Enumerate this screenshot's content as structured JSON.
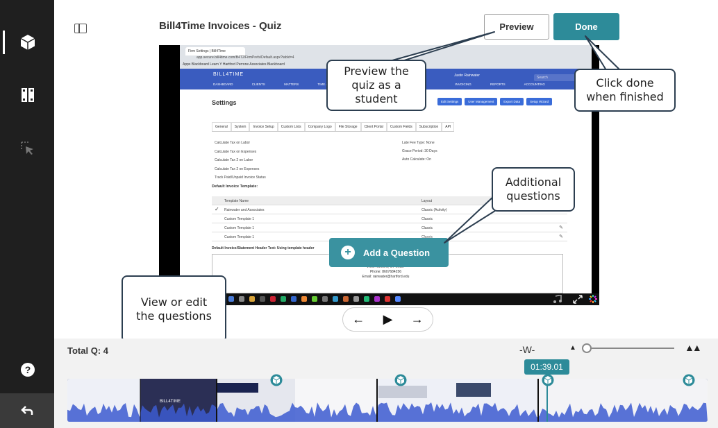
{
  "sidebar": {
    "items": [
      {
        "icon": "cube-icon",
        "active": true
      },
      {
        "icon": "split-video-icon",
        "active": false
      },
      {
        "icon": "cursor-select-icon",
        "active": false
      }
    ],
    "help_icon": "help-icon",
    "back_icon": "back-arrow-icon"
  },
  "header": {
    "title": "Bill4Time Invoices - Quiz",
    "preview_label": "Preview",
    "done_label": "Done"
  },
  "video": {
    "browser_tab": "Firm Settings | Bill4Time",
    "url": "app.secure.bill4time.com/B4T2/FirmPrefs/Default.aspx?tabId=4",
    "bookmarks": "Apps   Blackboard Learn   Y Hartford   Perrone Associates   Blackboard",
    "logo": "BILL4TIME",
    "nav": [
      "DASHBOARD",
      "CLIENTS",
      "MATTERS",
      "TIME & EXPENSES",
      "INVOICING",
      "REPORTS",
      "ACCOUNTING"
    ],
    "user": "Justin Rainwater",
    "search_placeholder": "Search",
    "settings_title": "Settings",
    "setting_buttons": [
      "Edit Settings",
      "User Management",
      "Export Data",
      "Setup Wizard"
    ],
    "tabs": [
      "General",
      "System",
      "Invoice Setup",
      "Custom Lists",
      "Company Logo",
      "File Storage",
      "Client Portal",
      "Custom Fields",
      "Subscription",
      "API"
    ],
    "options_left": [
      "Calculate Tax on Labor",
      "Calculate Tax on Expenses",
      "Calculate Tax 2 on Labor",
      "Calculate Tax 2 on Expenses",
      "Track Paid/Unpaid Invoice Status"
    ],
    "options_right": [
      "Late Fee Type:   None",
      "Grace Period:   30 Days",
      "Auto Calculate:   On"
    ],
    "default_template_heading": "Default Invoice Template:",
    "table_headers": [
      "Template Name",
      "Layout"
    ],
    "table_rows": [
      {
        "name": "Rainwater and Associates",
        "layout": "Classic (Activity)"
      },
      {
        "name": "Custom Template 1",
        "layout": "Classic"
      },
      {
        "name": "Custom Template 1",
        "layout": "Classic"
      },
      {
        "name": "Custom Template 1",
        "layout": "Classic"
      }
    ],
    "header_text_label": "Default Invoice/Statement Header Text:   Using template header",
    "address": [
      "Hartford",
      "West Hartford, CT 06117",
      "Phone: 8607684256",
      "Email: rainwater@hartford.edu"
    ],
    "add_question_label": "Add a Question"
  },
  "callouts": {
    "preview": "Preview the quiz as a student",
    "done": "Click done when finished",
    "additional": "Additional questions",
    "view_edit": "View or edit the questions"
  },
  "playback": {
    "prev_icon": "arrow-left-icon",
    "play_icon": "play-icon",
    "next_icon": "arrow-right-icon"
  },
  "timeline": {
    "total_label": "Total Q: 4",
    "zoom_level": 0.05,
    "current_time": "01:39.01",
    "question_markers": 4,
    "colors": {
      "accent": "#2d8b99",
      "wave": "#3c5ad0"
    }
  }
}
